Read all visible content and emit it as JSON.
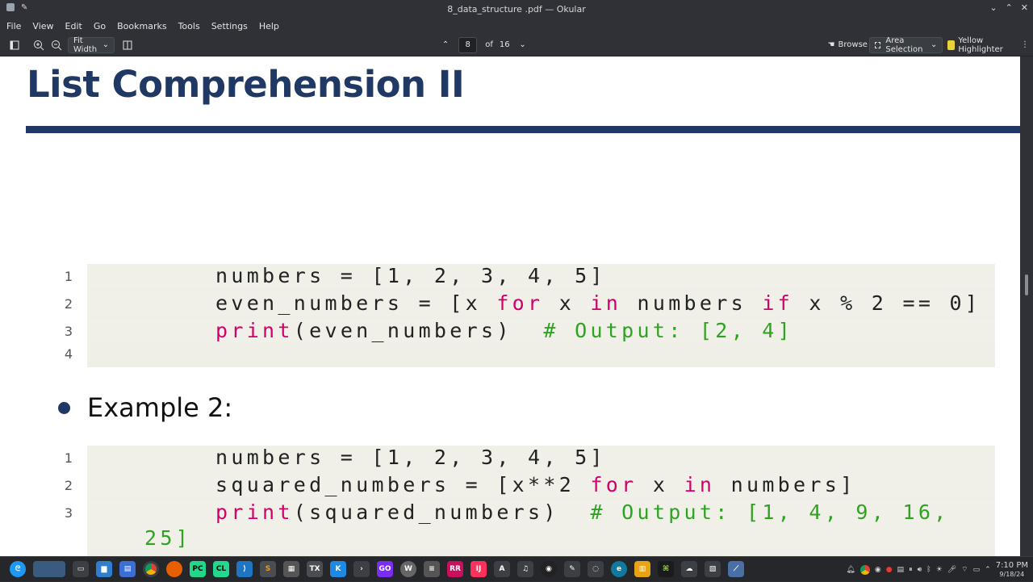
{
  "window": {
    "title": "8_data_structure .pdf — Okular",
    "controls": [
      "⌄",
      "⌃",
      "✕"
    ]
  },
  "menu": [
    "File",
    "View",
    "Edit",
    "Go",
    "Bookmarks",
    "Tools",
    "Settings",
    "Help"
  ],
  "toolbar": {
    "zoom": "Fit Width",
    "page_current": "8",
    "page_of": "of",
    "page_total": "16",
    "browse_label": "Browse",
    "area_selection_label": "Area Selection",
    "highlighter_label": "Yellow Highlighter"
  },
  "slide": {
    "title": "List Comprehension II",
    "code_block_1": [
      {
        "num": "1",
        "code": "numbers = [1, 2, 3, 4, 5]"
      },
      {
        "num": "2",
        "code": "even_numbers = [x for x in numbers if x % 2 == 0]"
      },
      {
        "num": "3",
        "code": "print(even_numbers)  # Output: [2, 4]"
      },
      {
        "num": "4",
        "code": ""
      }
    ],
    "example_label": "Example 2:",
    "code_block_2": [
      {
        "num": "1",
        "code": "numbers = [1, 2, 3, 4, 5]"
      },
      {
        "num": "2",
        "code": "squared_numbers = [x**2 for x in numbers]"
      },
      {
        "num": "3",
        "code": "print(squared_numbers)  # Output: [1, 4, 9, 16,"
      },
      {
        "num": "",
        "code": "25]"
      }
    ]
  },
  "taskbar": {
    "time": "7:10 PM",
    "date": "9/18/24"
  },
  "colors": {
    "title_blue": "#1f3864",
    "keyword": "#d1006b",
    "comment": "#2ea320",
    "code_bg": "#f0f0e9"
  }
}
